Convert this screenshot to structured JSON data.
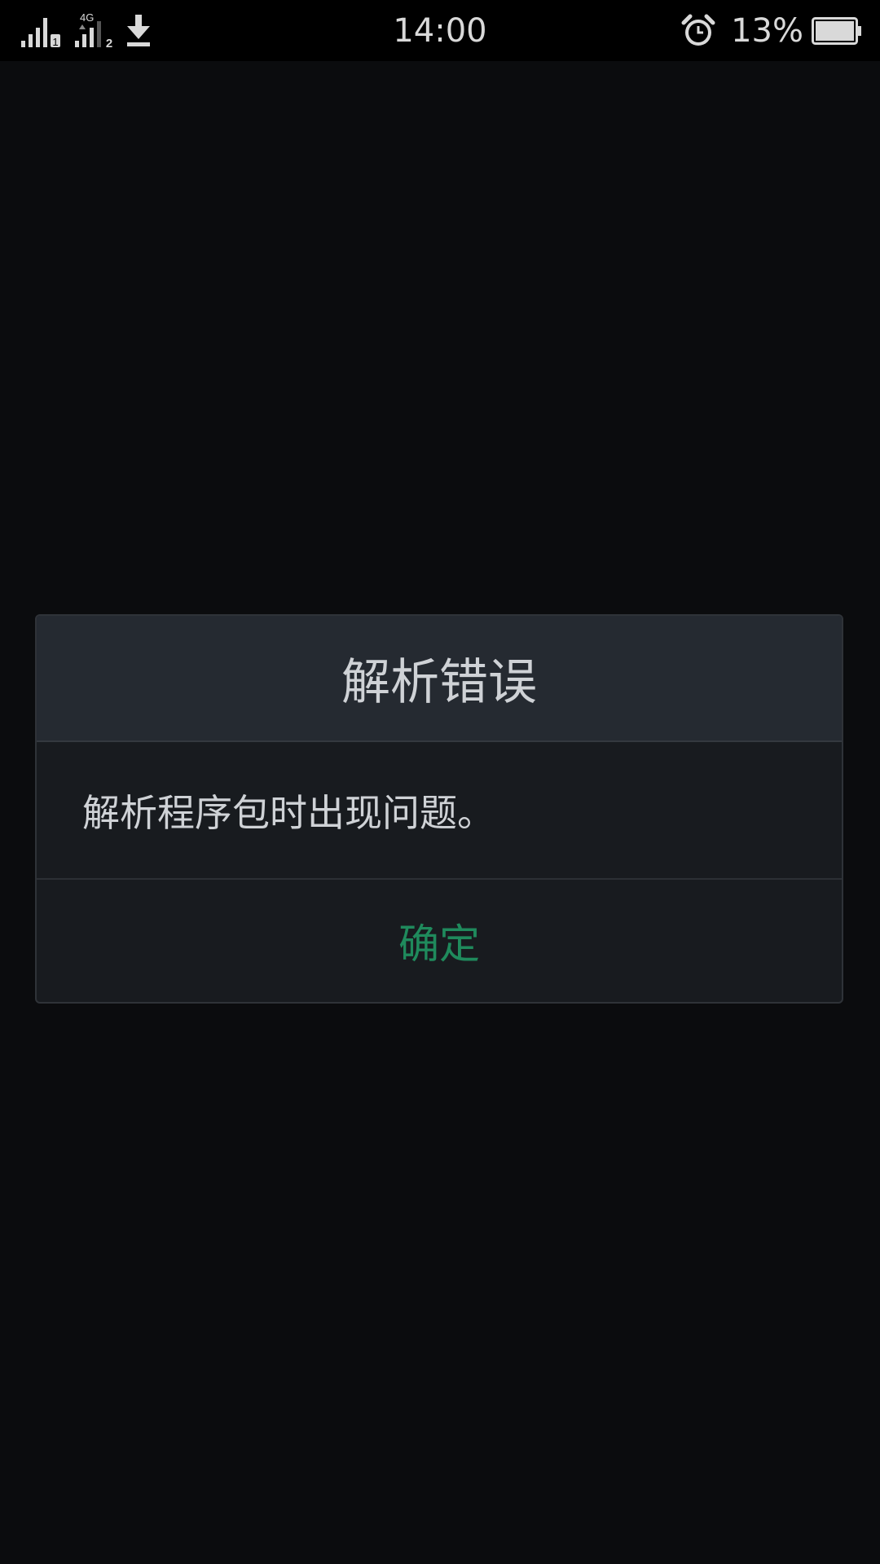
{
  "status_bar": {
    "network_type": "4G",
    "sim1_label": "1",
    "sim2_label": "2",
    "time": "14:00",
    "battery_percent": "13%",
    "battery_level": 0.13,
    "icons": [
      "signal-sim1-icon",
      "signal-sim2-icon",
      "download-icon",
      "alarm-icon",
      "battery-icon"
    ]
  },
  "dialog": {
    "title": "解析错误",
    "message": "解析程序包时出现问题。",
    "ok_label": "确定",
    "accent_color": "#1f8a5c"
  }
}
